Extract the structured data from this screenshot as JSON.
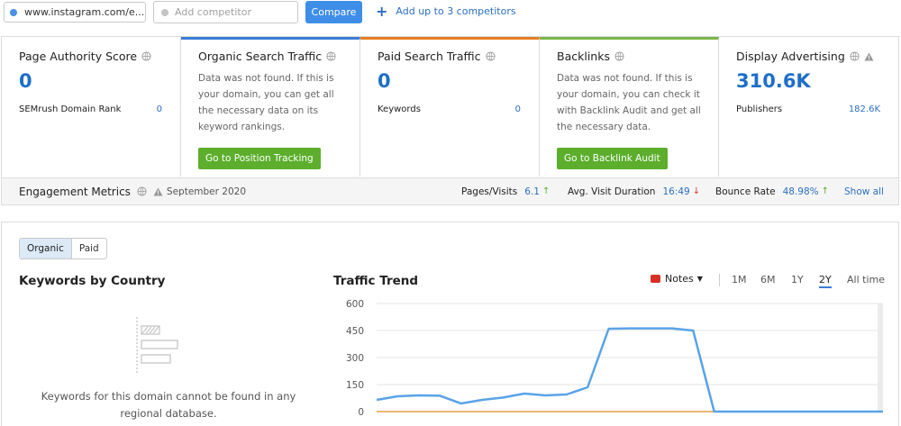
{
  "topbar": {
    "domain": "www.instagram.com/e...",
    "competitor_placeholder": "Add competitor",
    "compare_label": "Compare",
    "add_link_label": "Add up to 3 competitors",
    "domain_dot_color": "#4a90e2"
  },
  "cards": [
    {
      "title": "Page Authority Score",
      "value": "0",
      "sub_label": "SEMrush Domain Rank",
      "sub_value": "0"
    },
    {
      "title": "Organic Search Traffic",
      "message": "Data was not found. If this is your domain, you can get all the necessary data on its keyword rankings.",
      "button": "Go to Position Tracking",
      "accent": "#3c7dd8"
    },
    {
      "title": "Paid Search Traffic",
      "value": "0",
      "sub_label": "Keywords",
      "sub_value": "0",
      "accent": "#e67e22"
    },
    {
      "title": "Backlinks",
      "message": "Data was not found. If this is your domain, you can check it with Backlink Audit and get all the necessary data.",
      "button": "Go to Backlink Audit",
      "accent": "#7ab648"
    },
    {
      "title": "Display Advertising",
      "value": "310.6K",
      "sub_label": "Publishers",
      "sub_value": "182.6K"
    }
  ],
  "engagement": {
    "title": "Engagement Metrics",
    "date": "September 2020",
    "pages_visits_label": "Pages/Visits",
    "pages_visits_value": "6.1",
    "pages_visits_trend": "↑",
    "avg_visit_label": "Avg. Visit Duration",
    "avg_visit_value": "16:49",
    "avg_visit_trend": "↓",
    "bounce_label": "Bounce Rate",
    "bounce_value": "48.98%",
    "bounce_trend": "↑",
    "show_all": "Show all"
  },
  "panel": {
    "toggle": [
      "Organic",
      "Paid"
    ],
    "active_toggle": "Organic",
    "kbc_title": "Keywords by Country",
    "kbc_message": "Keywords for this domain cannot be found in any regional database.",
    "trend_title": "Traffic Trend",
    "notes_label": "Notes",
    "ranges": [
      "1M",
      "6M",
      "1Y",
      "2Y",
      "All time"
    ],
    "active_range": "2Y"
  },
  "chart_data": {
    "type": "line",
    "title": "Traffic Trend",
    "yticks": [
      "600",
      "450",
      "300",
      "150",
      "0"
    ],
    "ylim": [
      0,
      600
    ],
    "x": [
      0,
      1,
      2,
      3,
      4,
      5,
      6,
      7,
      8,
      9,
      10,
      11,
      12,
      13,
      14,
      15,
      16,
      17,
      18,
      19,
      20,
      21,
      22,
      23,
      24
    ],
    "series": [
      {
        "color": "#5aa3e8",
        "values": [
          65,
          85,
          90,
          88,
          45,
          65,
          78,
          100,
          90,
          95,
          135,
          460,
          462,
          462,
          462,
          450,
          0,
          0,
          0,
          0,
          0,
          0,
          0,
          0,
          0
        ]
      },
      {
        "color": "#e8a040",
        "values": [
          0,
          0,
          0,
          0,
          0,
          0,
          0,
          0,
          0,
          0,
          0,
          0,
          0,
          0,
          0,
          0,
          0,
          0,
          0,
          0,
          0,
          0,
          0,
          0,
          0
        ]
      }
    ],
    "grid": true
  }
}
